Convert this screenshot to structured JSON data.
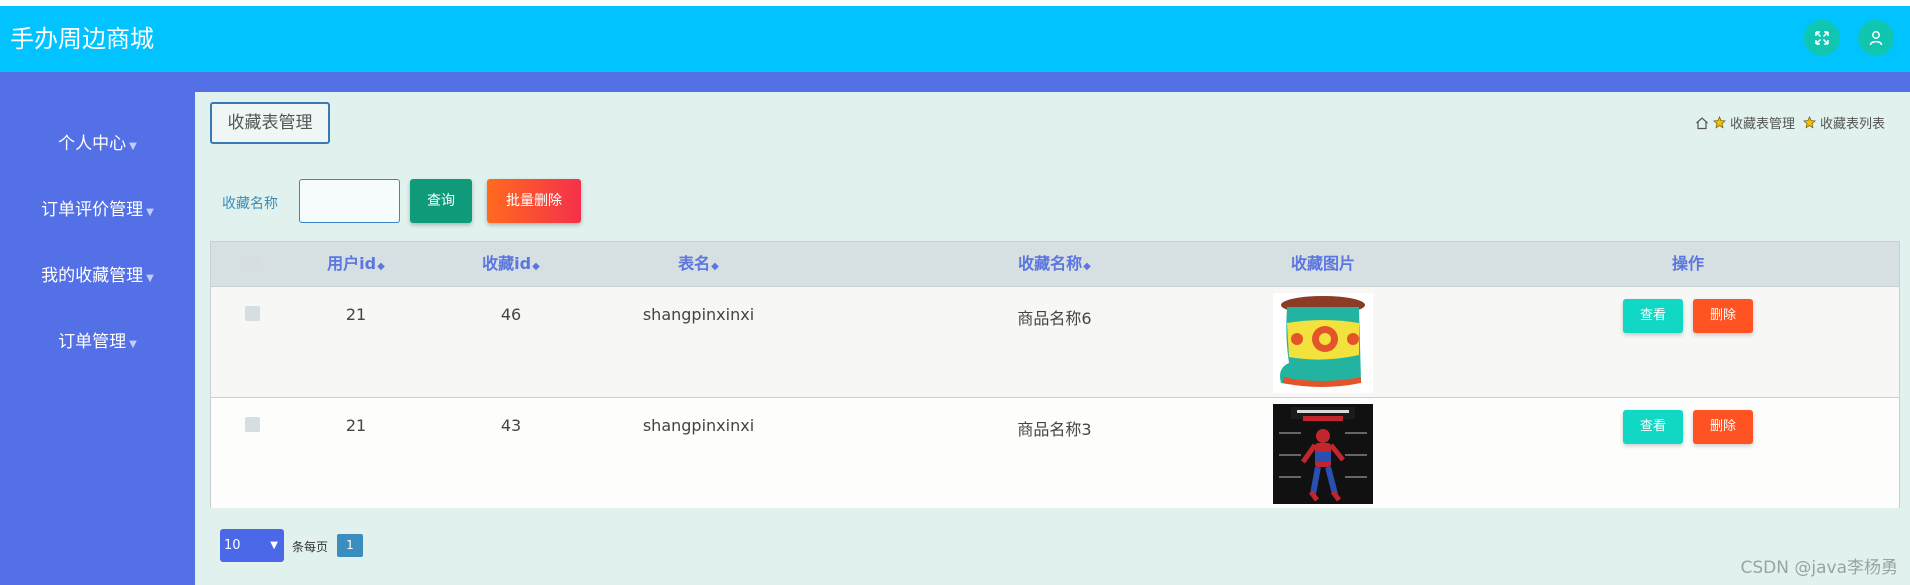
{
  "app": {
    "title": "手办周边商城"
  },
  "sidebar": {
    "items": [
      {
        "label": "个人中心"
      },
      {
        "label": "订单评价管理"
      },
      {
        "label": "我的收藏管理"
      },
      {
        "label": "订单管理"
      }
    ]
  },
  "page": {
    "tag": "收藏表管理",
    "breadcrumb": [
      "收藏表管理",
      "收藏表列表"
    ]
  },
  "search": {
    "label": "收藏名称",
    "value": "",
    "placeholder": "",
    "query_label": "查询",
    "batch_delete_label": "批量删除"
  },
  "table": {
    "columns": [
      "用户id",
      "收藏id",
      "表名",
      "收藏名称",
      "收藏图片",
      "操作"
    ],
    "rows": [
      {
        "user_id": "21",
        "fav_id": "46",
        "table_name": "shangpinxinxi",
        "fav_name": "商品名称6",
        "image": "hat-image"
      },
      {
        "user_id": "21",
        "fav_id": "43",
        "table_name": "shangpinxinxi",
        "fav_name": "商品名称3",
        "image": "spiderman-figure-image"
      }
    ],
    "actions": {
      "view": "查看",
      "delete": "删除"
    }
  },
  "pagination": {
    "page_size": "10",
    "per_page_label": "条每页",
    "current_page": "1"
  },
  "watermark": "CSDN @java李杨勇",
  "colors": {
    "topbar": "#00c3ff",
    "sidebar": "#5470e6",
    "content_bg": "#e1f2ee",
    "view_btn": "#10d8c5",
    "delete_btn": "#ff5323",
    "query_btn": "#0f9b7a"
  }
}
